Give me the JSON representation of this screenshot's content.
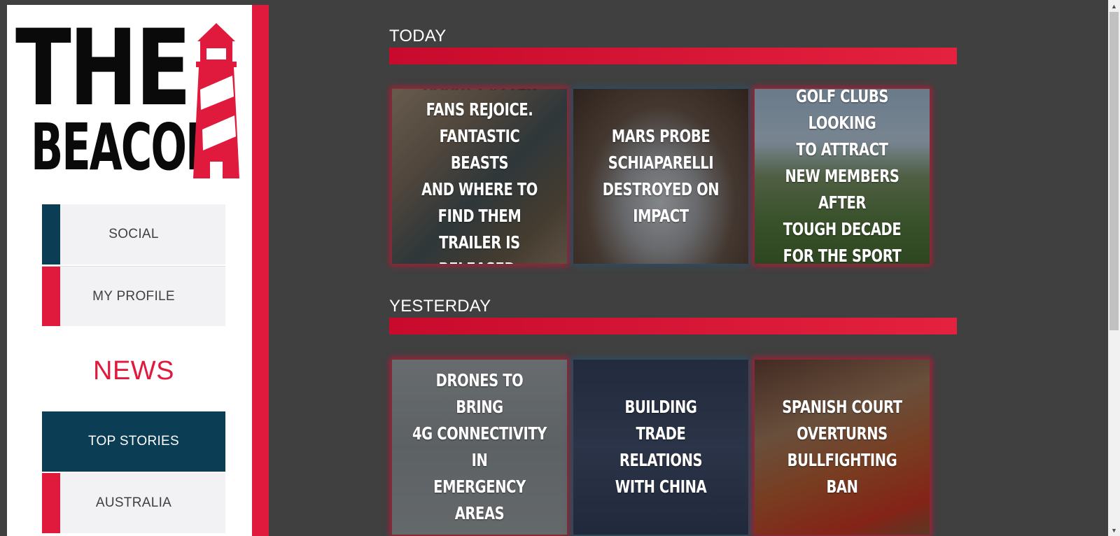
{
  "brand": {
    "logo_line1": "THE",
    "logo_line2": "BEACON",
    "accent_color": "#e01a3c",
    "dark_color": "#0b3d55"
  },
  "sidebar": {
    "items": [
      {
        "label": "SOCIAL",
        "accent": "#0b3d55"
      },
      {
        "label": "MY PROFILE",
        "accent": "#e01a3c"
      }
    ],
    "section_heading": "NEWS",
    "news_items": [
      {
        "label": "TOP STORIES",
        "active": true
      },
      {
        "label": "AUSTRALIA",
        "accent": "#e01a3c"
      }
    ]
  },
  "sections": [
    {
      "title": "TODAY",
      "cards": [
        {
          "headline": "HARRY POTTER\nFANS REJOICE.\nFANTASTIC BEASTS\nAND WHERE TO FIND THEM\nTRAILER IS RELEASED.",
          "glow": "red"
        },
        {
          "headline": "MARS PROBE\nSCHIAPARELLI\nDESTROYED ON IMPACT",
          "glow": "blue"
        },
        {
          "headline": "GOLF CLUBS LOOKING\nTO ATTRACT\nNEW MEMBERS AFTER\nTOUGH DECADE\nFOR THE SPORT",
          "glow": "red"
        }
      ]
    },
    {
      "title": "YESTERDAY",
      "cards": [
        {
          "headline": "DRONES TO BRING\n4G CONNECTIVITY IN\nEMERGENCY AREAS",
          "glow": "red"
        },
        {
          "headline": "BUILDING\nTRADE RELATIONS\nWITH CHINA",
          "glow": "blue"
        },
        {
          "headline": "SPANISH COURT\nOVERTURNS\nBULLFIGHTING BAN",
          "glow": "red"
        }
      ]
    }
  ]
}
